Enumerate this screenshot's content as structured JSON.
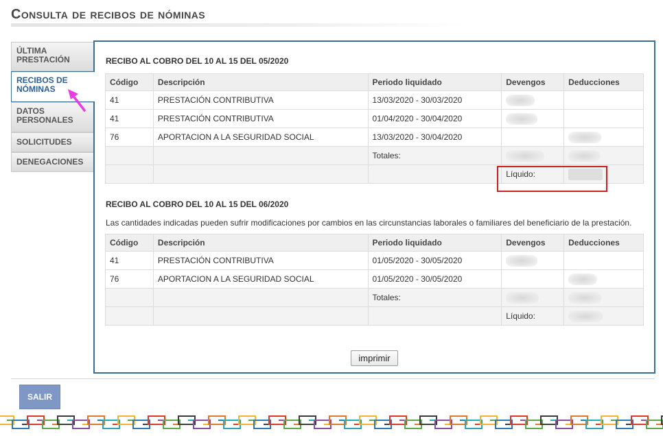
{
  "page": {
    "title": "Consulta de recibos de nóminas"
  },
  "tabs": [
    {
      "label": "ÚLTIMA PRESTACIÓN",
      "active": false
    },
    {
      "label": "RECIBOS DE NÓMINAS",
      "active": true
    },
    {
      "label": "DATOS PERSONALES",
      "active": false
    },
    {
      "label": "SOLICITUDES",
      "active": false
    },
    {
      "label": "DENEGACIONES",
      "active": false
    }
  ],
  "columns": [
    "Código",
    "Descripción",
    "Periodo liquidado",
    "Devengos",
    "Deducciones"
  ],
  "receipts": [
    {
      "title": "RECIBO AL COBRO DEL 10 AL 15 DEL 05/2020",
      "note": "",
      "rows": [
        {
          "code": "41",
          "description": "PRESTACIÓN CONTRIBUTIVA",
          "period": "13/03/2020  -  30/03/2020"
        },
        {
          "code": "41",
          "description": "PRESTACIÓN CONTRIBUTIVA",
          "period": "01/04/2020  -  30/04/2020"
        },
        {
          "code": "76",
          "description": "APORTACION A LA SEGURIDAD SOCIAL",
          "period": "13/03/2020  -  30/04/2020"
        }
      ],
      "totals_label": "Totales:",
      "net_label": "Líquido:"
    },
    {
      "title": "RECIBO AL COBRO DEL 10 AL 15 DEL 06/2020",
      "note": "Las cantidades indicadas pueden sufrir modificaciones por cambios en las circunstancias laborales o familiares del beneficiario de la prestación.",
      "rows": [
        {
          "code": "41",
          "description": "PRESTACIÓN CONTRIBUTIVA",
          "period": "01/05/2020  -  30/05/2020"
        },
        {
          "code": "76",
          "description": "APORTACION A LA SEGURIDAD SOCIAL",
          "period": "01/05/2020  -  30/05/2020"
        }
      ],
      "totals_label": "Totales:",
      "net_label": "Líquido:"
    }
  ],
  "actions": {
    "print_label": "imprimir",
    "exit_label": "SALIR"
  },
  "colors": {
    "accent": "#3b6c96",
    "highlight": "#cc1f1f",
    "annotation_arrow": "#e83de0",
    "exit_button": "#7f97c5"
  }
}
